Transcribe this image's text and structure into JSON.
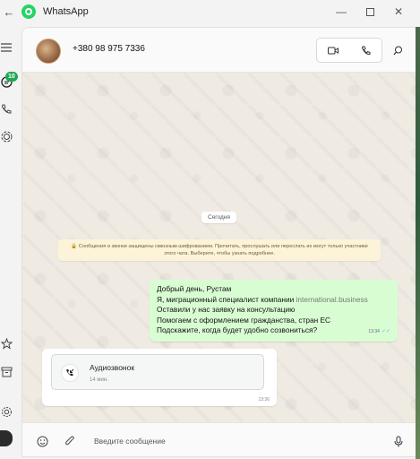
{
  "window": {
    "title": "WhatsApp",
    "back_icon": "arrow-left-icon",
    "controls": [
      "minimize-icon",
      "maximize-icon",
      "close-icon"
    ]
  },
  "rail": {
    "unread_badge": "10",
    "icons": [
      "menu-icon",
      "chats-icon",
      "calls-icon",
      "status-icon",
      "starred-icon",
      "archive-icon",
      "settings-icon",
      "profile-avatar"
    ]
  },
  "chat": {
    "contact_name": "+380 98 975 7336",
    "date_divider": "Сегодня",
    "encryption_note": "🔒 Сообщения и звонки защищены сквозным шифрованием. Прочитать, прослушать или переслать их могут только участники этого чата. Выберите, чтобы узнать подробнее.",
    "outgoing": {
      "lines": [
        "Добрый день, Рустам",
        "Я, миграционный специалист компании ",
        "Оставили у нас заявку на консультацию",
        "Помогаем с оформлением гражданства, стран ЕС",
        "Подскажите, когда будет удобно созвониться?"
      ],
      "link_text": "international.business",
      "time": "13:34"
    },
    "incoming_call": {
      "title": "Аудиозвонок",
      "duration": "14 мин.",
      "time": "13:36"
    }
  },
  "composer": {
    "placeholder": "Введите сообщение"
  },
  "colors": {
    "accent": "#25d366",
    "outgoing_bubble": "#d9fdd3",
    "chat_background": "#efeae2",
    "badge": "#1fa855"
  }
}
